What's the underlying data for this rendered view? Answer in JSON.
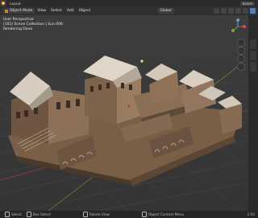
{
  "app": {
    "name": "Blender"
  },
  "topbar": {
    "tabs": [
      "Layout"
    ],
    "scene": "Scene"
  },
  "header": {
    "mode": "Object Mode",
    "menus": [
      "View",
      "Select",
      "Add",
      "Object"
    ],
    "orientation": "Global"
  },
  "viewport": {
    "perspective": "User Perspective",
    "collection": "(101) Scene Collection | Sun.006",
    "render_status": "Rendering Done"
  },
  "statusbar": {
    "items": [
      {
        "icon": "mouse-left-icon",
        "label": "Select"
      },
      {
        "icon": "mouse-left-icon",
        "label": "Box Select"
      },
      {
        "icon": "mouse-middle-icon",
        "label": "Rotate View"
      },
      {
        "icon": "mouse-right-icon",
        "label": "Object Context Menu"
      }
    ],
    "version": "2.93"
  },
  "colors": {
    "header_bg": "#303030",
    "viewport_bg": "#3a3a3a",
    "grid_line": "#4a4a4a",
    "axis_red": "#a33a3a",
    "axis_green": "#6e9a32"
  }
}
